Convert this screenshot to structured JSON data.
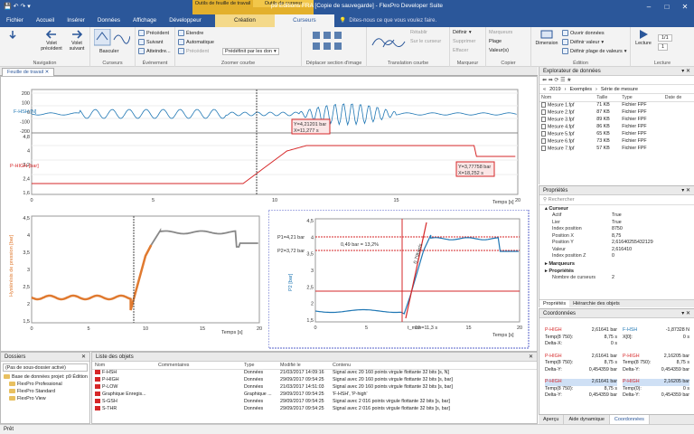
{
  "app": {
    "title": "p9 Editions FRA [Copie de sauvegarde] - FlexPro Developer Suite",
    "context_group": "Outils de feuille de travail",
    "context_group2": "Outils de curseur"
  },
  "menu": [
    "Fichier",
    "Accueil",
    "Insérer",
    "Données",
    "Affichage",
    "Développeur",
    "Création",
    "Curseurs"
  ],
  "tellme": "Dites-nous ce que vous voulez faire.",
  "ribbon": {
    "navigation": {
      "label": "Navigation",
      "prev": "Volet précédent",
      "next": "Volet suivant"
    },
    "curseurs": {
      "label": "Curseurs",
      "bascule": "Basculer"
    },
    "evenement": {
      "label": "Événement",
      "items": [
        "Précédent",
        "Suivant",
        "Atteindre..."
      ]
    },
    "zoomer": {
      "label": "Zoomer courbe",
      "items": [
        "Étendre",
        "Automatique",
        "Précédent"
      ],
      "preset": "Prédéfinit par les don"
    },
    "deplacer": {
      "label": "Déplacer section d'image"
    },
    "translation": {
      "label": "Translation courbe",
      "items": [
        "Rétablir",
        "Sur le curseur"
      ]
    },
    "marqueur": {
      "label": "Marqueur",
      "items": [
        "Définir",
        "Supprimer",
        "Effacer"
      ]
    },
    "copier": {
      "label": "Copier",
      "items": [
        "Marqueurs",
        "Plage",
        "Valeur(s)"
      ]
    },
    "edition": {
      "label": "Édition",
      "dimension": "Dimension",
      "items": [
        "Ouvrir données",
        "Définir valeur",
        "Définir plage de valeurs"
      ]
    },
    "lecture": {
      "label": "Lecture",
      "lecture": "Lecture",
      "speed1": "1/1",
      "speed2": "1"
    }
  },
  "worksheet": {
    "tab": "Feuille de travail"
  },
  "chart_data": [
    {
      "type": "line",
      "title": "",
      "xlabel": "Temps [s]",
      "xlim": [
        0,
        20
      ],
      "series": [
        {
          "name": "F-HSH [N]",
          "color": "#1f77b4",
          "ylim": [
            -200,
            200
          ]
        },
        {
          "name": "P-HIGH [bar]",
          "color": "#d62728",
          "ylim": [
            1.6,
            4.8
          ]
        }
      ],
      "yticks_top": [
        "200",
        "100",
        "0",
        "-100",
        "-200"
      ],
      "yticks_bottom": [
        "4,8",
        "4",
        "3,2",
        "2,4",
        "1,6"
      ],
      "xticks": [
        "0",
        "5",
        "10",
        "15",
        "20"
      ],
      "annotations": [
        "Y=4,21201 bar",
        "X=11,277 s",
        "Y=3,77758 bar",
        "X=18,252 s"
      ]
    },
    {
      "type": "line",
      "title": "",
      "xlabel": "Temps [s]",
      "ylabel": "Hystérésis de pression [bar]",
      "xlim": [
        0,
        20
      ],
      "ylim": [
        1.5,
        4.5
      ],
      "yticks": [
        "4,5",
        "4",
        "3,5",
        "3",
        "2,5",
        "2",
        "1,5"
      ],
      "xticks": [
        "0",
        "5",
        "10",
        "15",
        "20"
      ]
    },
    {
      "type": "line",
      "title": "",
      "xlabel": "Temps [s]",
      "ylabel": "P2 [bar]",
      "xlim": [
        0,
        20
      ],
      "ylim": [
        1.5,
        4.5
      ],
      "yticks": [
        "4,5",
        "4",
        "3,5",
        "3",
        "2,5",
        "2",
        "1,5"
      ],
      "xticks": [
        "0",
        "5",
        "10",
        "15",
        "20"
      ],
      "annotations": [
        "P1=4,21 bar",
        "P2=3,72 bar",
        "0,49 bar = 13,2%",
        "0,79bar/s",
        "t_mon=11,3 s"
      ]
    }
  ],
  "explorer": {
    "title": "Explorateur de données",
    "path": [
      "2019",
      "Exemples",
      "Série de mesure"
    ],
    "columns": [
      "Nom",
      "Taille",
      "Type",
      "Date de"
    ],
    "files": [
      {
        "name": "Mesure 1.fpf",
        "size": "71 KB",
        "type": "Fichier FPF"
      },
      {
        "name": "Mesure 2.fpf",
        "size": "87 KB",
        "type": "Fichier FPF"
      },
      {
        "name": "Mesure 3.fpf",
        "size": "89 KB",
        "type": "Fichier FPF"
      },
      {
        "name": "Mesure 4.fpf",
        "size": "86 KB",
        "type": "Fichier FPF"
      },
      {
        "name": "Mesure 5.fpf",
        "size": "65 KB",
        "type": "Fichier FPF"
      },
      {
        "name": "Mesure 6.fpf",
        "size": "73 KB",
        "type": "Fichier FPF"
      },
      {
        "name": "Mesure 7.fpf",
        "size": "57 KB",
        "type": "Fichier FPF"
      }
    ]
  },
  "properties": {
    "title": "Propriétés",
    "search": "Rechercher",
    "section": "Curseur",
    "rows": [
      {
        "k": "Actif",
        "v": "True"
      },
      {
        "k": "Lier",
        "v": "True"
      },
      {
        "k": "Index position",
        "v": "8750"
      },
      {
        "k": "Position X",
        "v": "8,75"
      },
      {
        "k": "Position Y",
        "v": "2,61640255432129"
      },
      {
        "k": "Valeur",
        "v": "2,616410"
      },
      {
        "k": "Index position Z",
        "v": "0"
      }
    ],
    "sections2": [
      "Marqueurs",
      "Propriétés"
    ],
    "extra": {
      "k": "Nombre de curseurs",
      "v": "2"
    },
    "tabs": [
      "Propriétés",
      "Hiérarchie des objets"
    ]
  },
  "coords": {
    "title": "Coordonnées",
    "left": {
      "name1": "P-HIGH",
      "val1": "2,61641 bar",
      "temp1": "Temp(8 750):",
      "tv1": "8,75 s",
      "dx": "Delta-X:",
      "dxv": "0 s",
      "name2": "P-HIGH",
      "val2": "2,61641 bar",
      "temp2": "Temp(8 750):",
      "tv2": "8,75 s",
      "dy": "Delta-Y:",
      "dyv": "0,454359 bar",
      "name3": "P-HIGH",
      "val3": "2,61641 bar",
      "temp3": "Temp(8 750):",
      "tv3": "8,75 s",
      "dy3": "Delta-Y:",
      "dyv3": "0,454359 bar"
    },
    "right": {
      "name1": "F-HSH",
      "val1": "-1,87328 N",
      "x1": "X[0]:",
      "xv1": "0 s",
      "name2": "P-HIGH",
      "val2": "2,16205 bar",
      "temp2": "Temp(8 750):",
      "tv2": "8,75 s",
      "dy": "Delta-Y:",
      "dyv": "0,454359 bar",
      "name3": "P-HIGH",
      "val3": "2,16205 bar",
      "temp3": "Temp(0):",
      "tv3": "0 s",
      "dy3": "Delta-Y:",
      "dyv3": "0,454359 bar"
    }
  },
  "bottomtabs": [
    "Aperçu",
    "Aide dynamique",
    "Coordonnées"
  ],
  "folders": {
    "title": "Dossiers",
    "filter": "(Pas de sous-dossier activé)",
    "items": [
      "Base de données projet: p9 Édition",
      "FlexPro Professional",
      "FlexPro Standard",
      "FlexPro View"
    ]
  },
  "objects": {
    "title": "Liste des objets",
    "columns": [
      "Nom",
      "Commentaires",
      "Type",
      "Modifié le",
      "Contenu"
    ],
    "rows": [
      {
        "n": "F-HSH",
        "c": "",
        "t": "Données",
        "m": "21/03/2017 14:09:16",
        "x": "Signal avec 20 160 points virgule flottante 32 bits [s, N]"
      },
      {
        "n": "P-HIGH",
        "c": "",
        "t": "Données",
        "m": "29/09/2017 09:54:25",
        "x": "Signal avec 20 160 points virgule flottante 32 bits [s, bar]"
      },
      {
        "n": "P-LOW",
        "c": "",
        "t": "Données",
        "m": "21/03/2017 14:51:03",
        "x": "Signal avec 20 160 points virgule flottante 32 bits [s, bar]"
      },
      {
        "n": "Graphique Enregis...",
        "c": "",
        "t": "Graphique ...",
        "m": "29/09/2017 09:54:25",
        "x": "'F-HSH', 'P-high'"
      },
      {
        "n": "S-GSH",
        "c": "",
        "t": "Données",
        "m": "29/09/2017 09:54:25",
        "x": "Signal avec 2 016 points virgule flottante 32 bits [s, bar]"
      },
      {
        "n": "S-THR",
        "c": "",
        "t": "Données",
        "m": "29/09/2017 09:54:25",
        "x": "Signal avec 2 016 points virgule flottante 32 bits [s, bar]"
      }
    ]
  },
  "status": "Prêt"
}
